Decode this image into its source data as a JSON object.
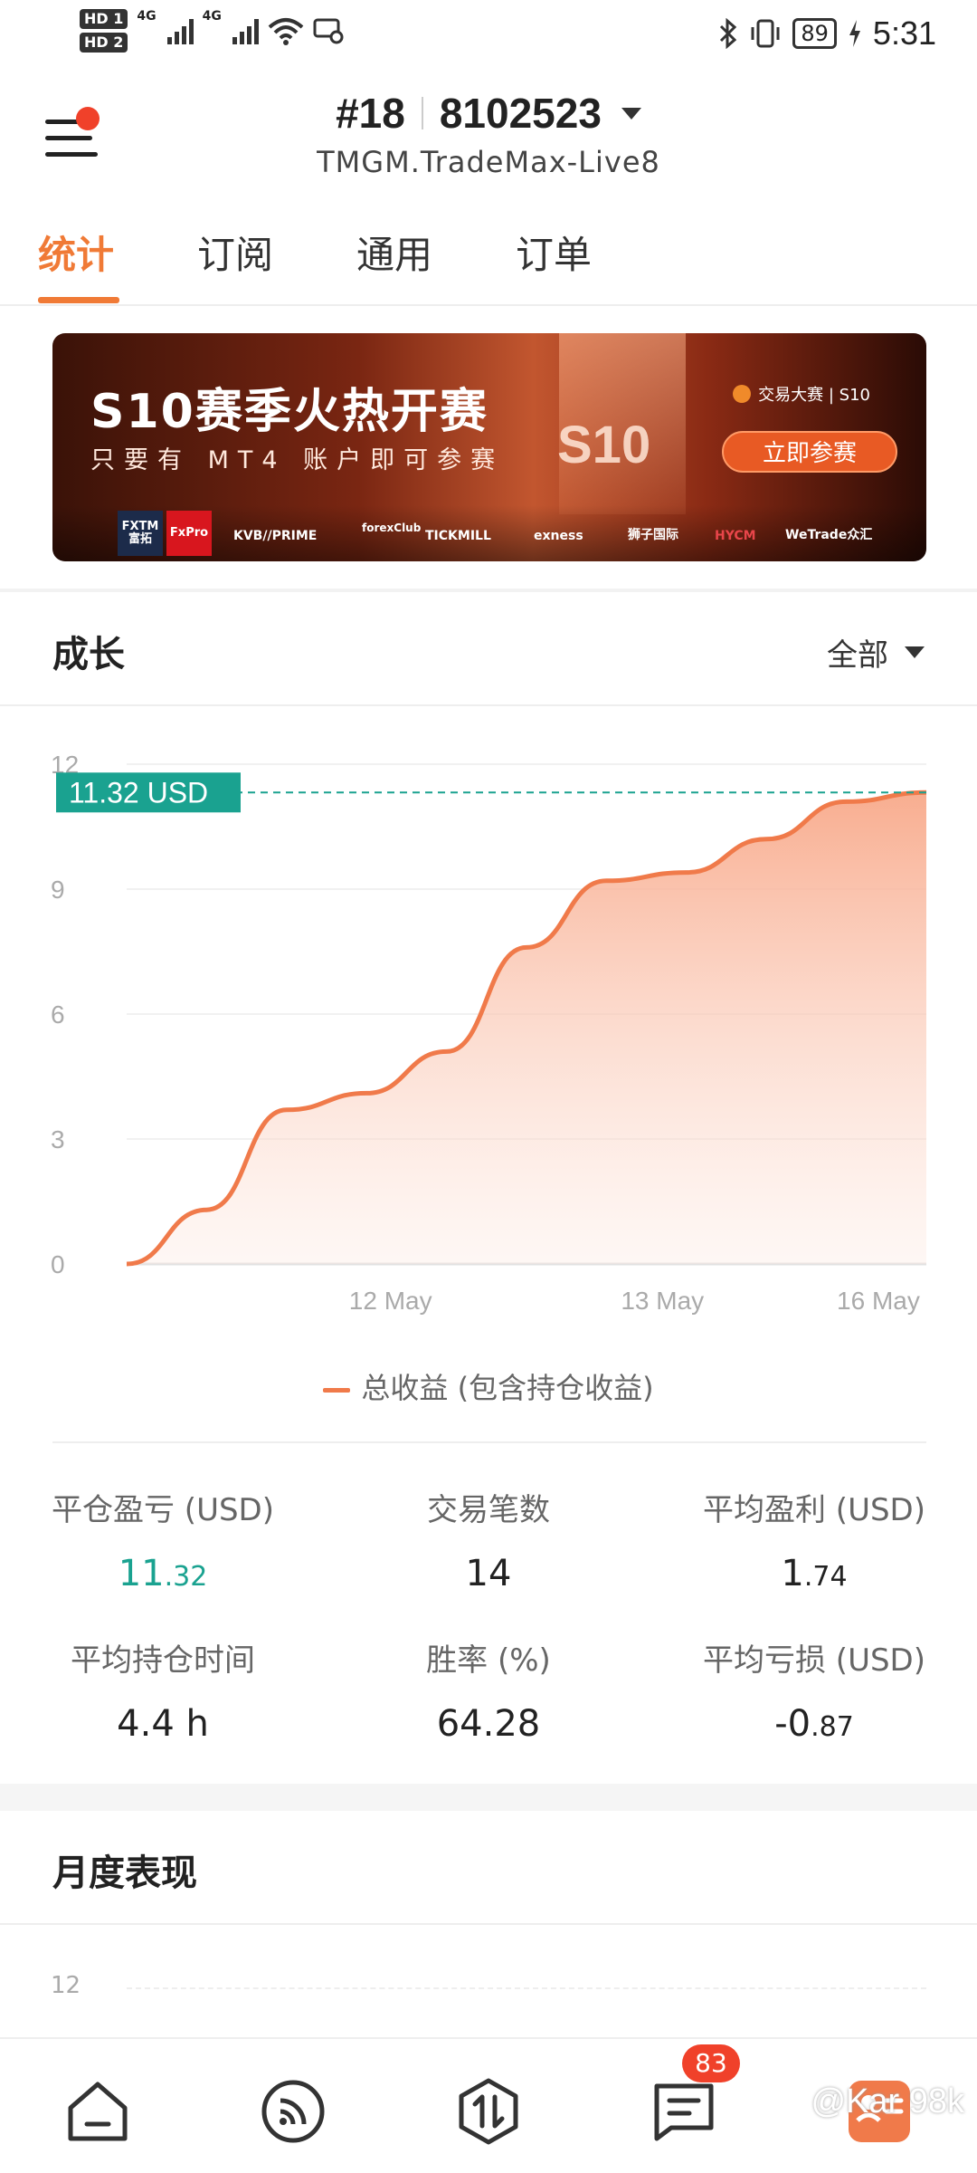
{
  "status_bar": {
    "hd1": "HD 1",
    "hd2": "HD 2",
    "net1": "4G",
    "net2": "4G",
    "battery": "89",
    "time": "5:31"
  },
  "header": {
    "account_number": "#18",
    "account_id": "8102523",
    "server": "TMGM.TradeMax-Live8"
  },
  "tabs": [
    {
      "label": "统计",
      "active": true
    },
    {
      "label": "订阅",
      "active": false
    },
    {
      "label": "通用",
      "active": false
    },
    {
      "label": "订单",
      "active": false
    }
  ],
  "banner": {
    "title": "S10赛季火热开赛",
    "subtitle": "只要有 MT4 账户即可参赛",
    "s10_mark": "S10",
    "contest_label": "交易大赛 | S10",
    "cta": "立即参赛",
    "sponsors": [
      "FXTM 富拓",
      "FxPro",
      "KVB//PRIME",
      "forexClub",
      "TICKMILL",
      "exness",
      "狮子国际",
      "HYCM",
      "WeTrade众汇"
    ]
  },
  "growth": {
    "title": "成长",
    "range": "全部",
    "current_value_label": "11.32 USD",
    "legend": "总收益 (包含持仓收益)"
  },
  "chart_data": {
    "type": "area",
    "title": "",
    "xlabel": "",
    "ylabel": "",
    "ylim": [
      0,
      12
    ],
    "yticks": [
      "12",
      "9",
      "6",
      "3",
      "0"
    ],
    "xticks": [
      "12 May",
      "13 May",
      "16 May"
    ],
    "series": [
      {
        "name": "总收益 (包含持仓收益)",
        "color": "#f07a4a",
        "x": [
          0,
          1,
          2,
          3,
          4,
          5,
          6,
          7,
          8,
          9,
          10
        ],
        "values": [
          0,
          1.3,
          3.7,
          4.1,
          5.1,
          7.6,
          9.2,
          9.4,
          10.2,
          11.1,
          11.32
        ]
      }
    ],
    "reference_line": {
      "value": 11.32,
      "label": "11.32 USD",
      "color": "#1aa290"
    },
    "grid": true
  },
  "stats": [
    {
      "label": "平仓盈亏 (USD)",
      "int": "11",
      "dec": ".32",
      "positive": true
    },
    {
      "label": "交易笔数",
      "int": "14",
      "dec": "",
      "positive": false
    },
    {
      "label": "平均盈利 (USD)",
      "int": "1",
      "dec": ".74",
      "positive": false
    },
    {
      "label": "平均持仓时间",
      "int": "4.4 h",
      "dec": "",
      "positive": false
    },
    {
      "label": "胜率 (%)",
      "int": "64.28",
      "dec": "",
      "positive": false
    },
    {
      "label": "平均亏损 (USD)",
      "int": "-0",
      "dec": ".87",
      "positive": false
    }
  ],
  "monthly": {
    "title": "月度表现",
    "top_tick": "12"
  },
  "bottom_nav": {
    "messages_badge": "83",
    "watermark": "@Kar 98k"
  },
  "colors": {
    "accent": "#f07a36",
    "positive": "#1aa290",
    "badge": "#f0412a"
  }
}
